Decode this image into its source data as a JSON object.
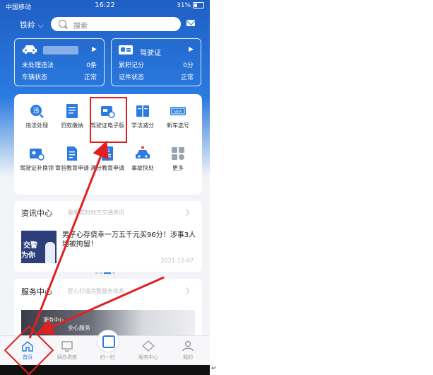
{
  "status_bar": {
    "carrier": "中国移动",
    "time": "16:22",
    "battery": "31%"
  },
  "header": {
    "city": "铁岭",
    "search_placeholder": "搜索"
  },
  "vehicle_card": {
    "violations_label": "未处理违法",
    "violations_value": "0条",
    "status_label": "车辆状态",
    "status_value": "正常"
  },
  "license_card": {
    "title": "驾驶证",
    "points_label": "累积记分",
    "points_value": "0分",
    "status_label": "证件状态",
    "status_value": "正常"
  },
  "services": [
    {
      "label": "违法处理",
      "icon": "violation-icon"
    },
    {
      "label": "罚款缴纳",
      "icon": "fine-icon"
    },
    {
      "label": "驾驶证电子版",
      "icon": "e-license-icon"
    },
    {
      "label": "学法减分",
      "icon": "book-icon"
    },
    {
      "label": "新车选号",
      "icon": "plate-icon"
    },
    {
      "label": "驾驶证补换领",
      "icon": "license-renew-icon"
    },
    {
      "label": "审验教育申请",
      "icon": "document-icon"
    },
    {
      "label": "满分教育申请",
      "icon": "document-12-icon"
    },
    {
      "label": "事故快处",
      "icon": "accident-icon"
    },
    {
      "label": "更多",
      "icon": "more-icon"
    }
  ],
  "news": {
    "title": "资讯中心",
    "subtitle": "最新实时地方交通资讯",
    "headline": "男子心存侥幸一万五千元买96分！涉事3人均被拘留！",
    "date": "2021-12-07",
    "thumb_text_1": "交警",
    "thumb_text_2": "为你"
  },
  "service_center": {
    "title": "服务中心",
    "subtitle": "匠心打造完整服务体系",
    "image_label": "全心服务",
    "image_tag": "服务中心"
  },
  "tabs": [
    {
      "label": "首页",
      "icon": "home-icon",
      "active": true
    },
    {
      "label": "网办进度",
      "icon": "monitor-icon"
    },
    {
      "label": "扫一扫",
      "icon": "scan-icon"
    },
    {
      "label": "服务中心",
      "icon": "diamond-icon"
    },
    {
      "label": "我的",
      "icon": "user-icon"
    }
  ],
  "colors": {
    "brand_blue": "#2b7be0",
    "highlight_red": "#e02020"
  }
}
